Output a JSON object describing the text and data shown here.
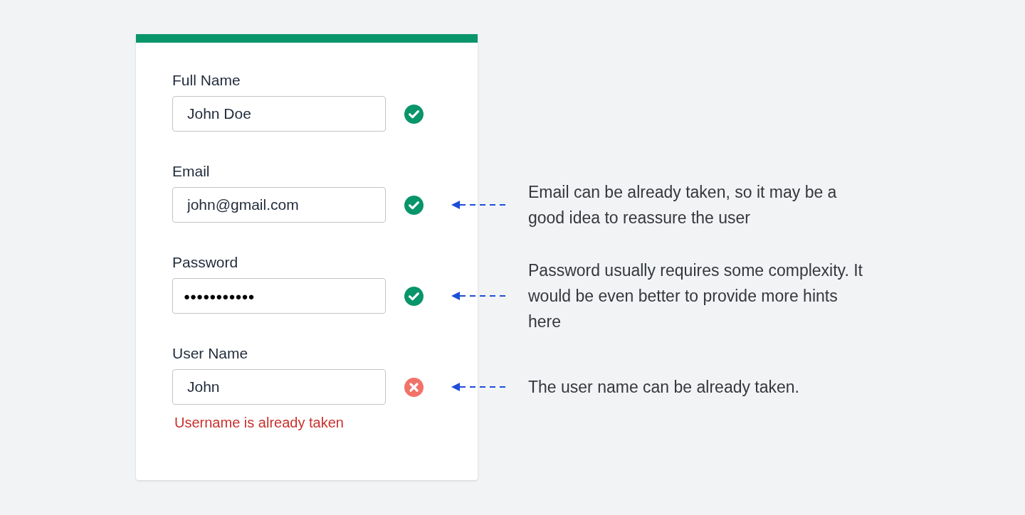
{
  "form": {
    "fields": [
      {
        "label": "Full Name",
        "value": "John Doe",
        "kind": "text",
        "valid": true
      },
      {
        "label": "Email",
        "value": "john@gmail.com",
        "kind": "text",
        "valid": true,
        "annotation": "Email can be already taken, so it may be a good idea to reassure the user"
      },
      {
        "label": "Password",
        "value": "●●●●●●●●●●●",
        "kind": "password",
        "valid": true,
        "annotation": "Password usually requires some complexity. It would be even better to provide more hints here"
      },
      {
        "label": "User Name",
        "value": "John",
        "kind": "text",
        "valid": false,
        "error": "Username is already taken",
        "annotation": "The user name can be already taken."
      }
    ]
  }
}
